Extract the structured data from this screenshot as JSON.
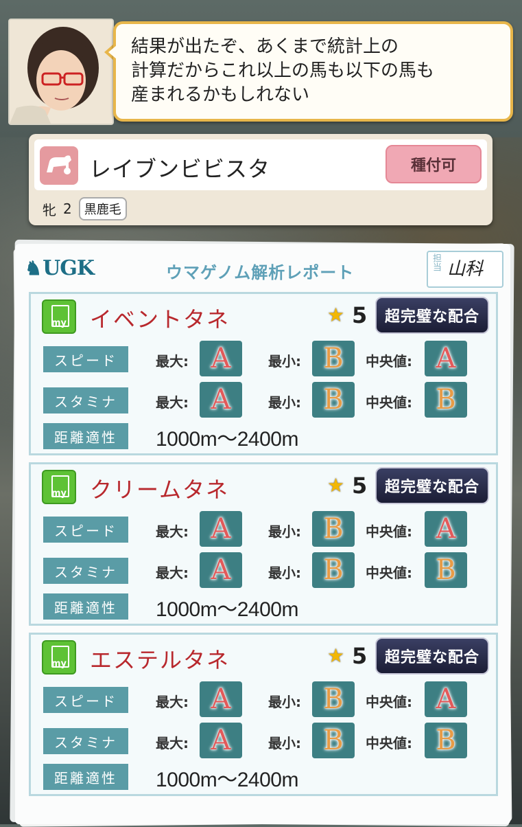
{
  "dialog": {
    "text": "結果が出たぞ、あくまで統計上の\n計算だからこれ以上の馬も以下の馬も\n産まれるかもしれない"
  },
  "horse": {
    "name": "レイブンビビスタ",
    "action_label": "種付可",
    "sex": "牝",
    "age": "2",
    "coat": "黒鹿毛"
  },
  "report": {
    "logo": "UGK",
    "title": "ウマゲノム解析レポート",
    "tanto_label": "担当",
    "tanto_sign": "山科",
    "labels": {
      "speed": "スピード",
      "stamina": "スタミナ",
      "distance": "距離適性",
      "max": "最大:",
      "min": "最小:",
      "median": "中央値:"
    },
    "sections": [
      {
        "name": "イベントタネ",
        "icon_text": "my",
        "stars": "5",
        "rank": "超完璧な配合",
        "speed": {
          "max": "A",
          "min": "B",
          "median": "A"
        },
        "stamina": {
          "max": "A",
          "min": "B",
          "median": "B"
        },
        "distance": "1000m〜2400m"
      },
      {
        "name": "クリームタネ",
        "icon_text": "my",
        "stars": "5",
        "rank": "超完璧な配合",
        "speed": {
          "max": "A",
          "min": "B",
          "median": "A"
        },
        "stamina": {
          "max": "A",
          "min": "B",
          "median": "B"
        },
        "distance": "1000m〜2400m"
      },
      {
        "name": "エステルタネ",
        "icon_text": "my",
        "stars": "5",
        "rank": "超完璧な配合",
        "speed": {
          "max": "A",
          "min": "B",
          "median": "A"
        },
        "stamina": {
          "max": "A",
          "min": "B",
          "median": "B"
        },
        "distance": "1000m〜2400m"
      }
    ]
  }
}
